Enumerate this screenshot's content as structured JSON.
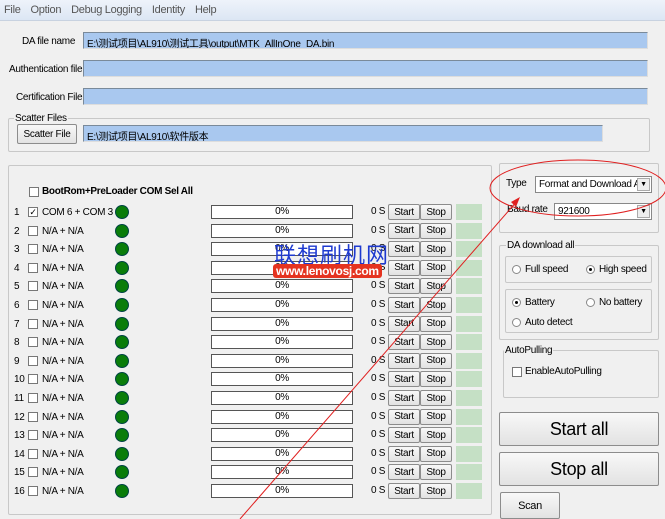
{
  "menu": [
    "File",
    "Option",
    "Debug Logging",
    "Identity",
    "Help"
  ],
  "files": {
    "da_label": "DA file name",
    "da_value": "E:\\测试项目\\AL910\\测试工具\\output\\MTK_AllInOne_DA.bin",
    "auth_label": "Authentication file",
    "auth_value": "",
    "cert_label": "Certification File",
    "cert_value": "",
    "scatter_group": "Scatter Files",
    "scatter_button": "Scatter File",
    "scatter_value": "E:\\测试项目\\AL910\\软件版本"
  },
  "sel_all": "BootRom+PreLoader COM Sel All",
  "rows": [
    {
      "n": "1",
      "checked": true,
      "port": "COM 6 + COM 3",
      "progress": "0%",
      "time": "0 S"
    },
    {
      "n": "2",
      "checked": false,
      "port": "N/A + N/A",
      "progress": "0%",
      "time": "0 S"
    },
    {
      "n": "3",
      "checked": false,
      "port": "N/A + N/A",
      "progress": "0%",
      "time": "0 S"
    },
    {
      "n": "4",
      "checked": false,
      "port": "N/A + N/A",
      "progress": "0%",
      "time": "0 S"
    },
    {
      "n": "5",
      "checked": false,
      "port": "N/A + N/A",
      "progress": "0%",
      "time": "0 S"
    },
    {
      "n": "6",
      "checked": false,
      "port": "N/A + N/A",
      "progress": "0%",
      "time": "0 S"
    },
    {
      "n": "7",
      "checked": false,
      "port": "N/A + N/A",
      "progress": "0%",
      "time": "0 S"
    },
    {
      "n": "8",
      "checked": false,
      "port": "N/A + N/A",
      "progress": "0%",
      "time": "0 S"
    },
    {
      "n": "9",
      "checked": false,
      "port": "N/A + N/A",
      "progress": "0%",
      "time": "0 S"
    },
    {
      "n": "10",
      "checked": false,
      "port": "N/A + N/A",
      "progress": "0%",
      "time": "0 S"
    },
    {
      "n": "11",
      "checked": false,
      "port": "N/A + N/A",
      "progress": "0%",
      "time": "0 S"
    },
    {
      "n": "12",
      "checked": false,
      "port": "N/A + N/A",
      "progress": "0%",
      "time": "0 S"
    },
    {
      "n": "13",
      "checked": false,
      "port": "N/A + N/A",
      "progress": "0%",
      "time": "0 S"
    },
    {
      "n": "14",
      "checked": false,
      "port": "N/A + N/A",
      "progress": "0%",
      "time": "0 S"
    },
    {
      "n": "15",
      "checked": false,
      "port": "N/A + N/A",
      "progress": "0%",
      "time": "0 S"
    },
    {
      "n": "16",
      "checked": false,
      "port": "N/A + N/A",
      "progress": "0%",
      "time": "0 S"
    }
  ],
  "row_buttons": {
    "start": "Start",
    "stop": "Stop"
  },
  "settings": {
    "type_label": "Type",
    "type_value": "Format and Download All",
    "baud_label": "Baud rate",
    "baud_value": "921600",
    "da_group": "DA download all",
    "full_speed": "Full speed",
    "high_speed": "High speed",
    "battery": "Battery",
    "no_battery": "No battery",
    "auto_detect": "Auto detect",
    "autopull_group": "AutoPulling",
    "enable_autopull": "EnableAutoPulling"
  },
  "actions": {
    "start_all": "Start all",
    "stop_all": "Stop all",
    "scan": "Scan"
  },
  "watermark": {
    "cn": "联想刷机网",
    "url": "www.lenovosj.com"
  }
}
